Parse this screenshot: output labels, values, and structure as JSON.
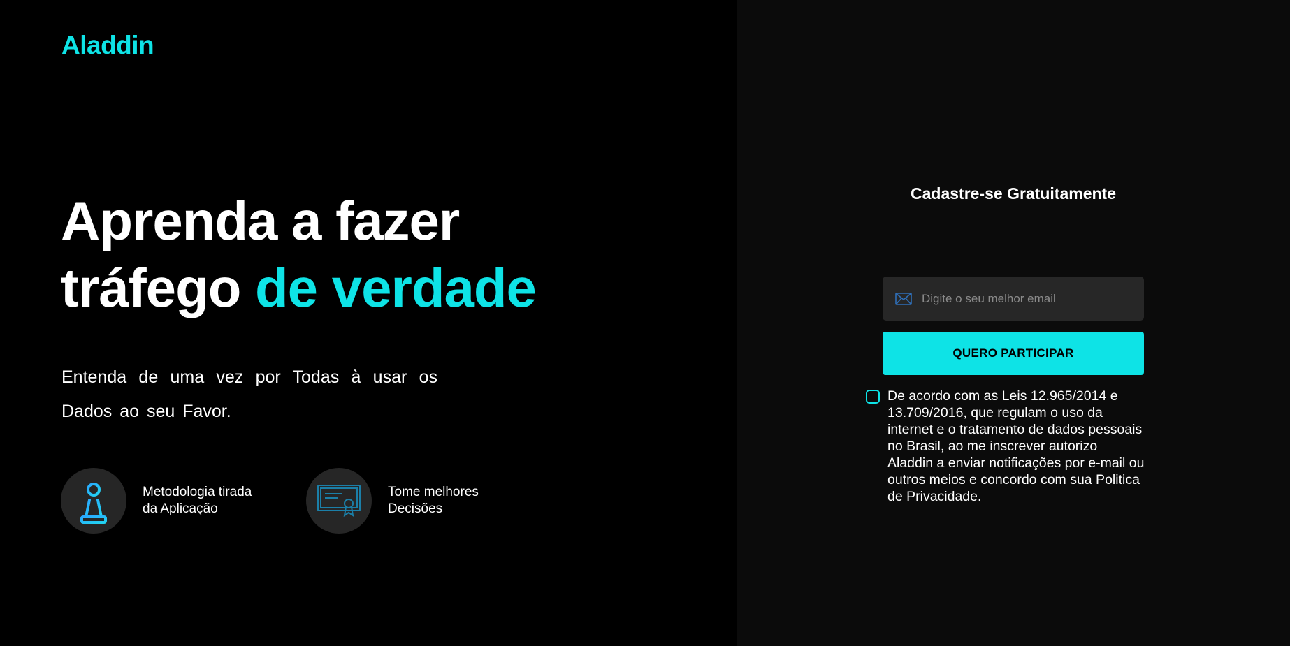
{
  "brand": {
    "logo": "Aladdin",
    "accent_color": "#0ee3e6"
  },
  "hero": {
    "headline_line1": "Aprenda a fazer",
    "headline_line2_plain": "tráfego ",
    "headline_line2_accent": "de verdade",
    "subtitle": "Entenda de uma vez por Todas à usar os Dados ao seu Favor."
  },
  "features": [
    {
      "icon": "chess-pawn-icon",
      "text": "Metodologia tirada\nda Aplicação"
    },
    {
      "icon": "certificate-icon",
      "text": "Tome melhores\nDecisões"
    }
  ],
  "form": {
    "title": "Cadastre-se Gratuitamente",
    "email_placeholder": "Digite o seu melhor email",
    "email_value": "",
    "submit_label": "QUERO PARTICIPAR",
    "consent_checked": false,
    "consent_text": "De acordo com as Leis 12.965/2014 e 13.709/2016, que regulam o uso da internet e o tratamento de dados pessoais no Brasil, ao me inscrever autorizo Aladdin a enviar notificações por e-mail ou outros meios e concordo com sua Politica de Privacidade."
  }
}
